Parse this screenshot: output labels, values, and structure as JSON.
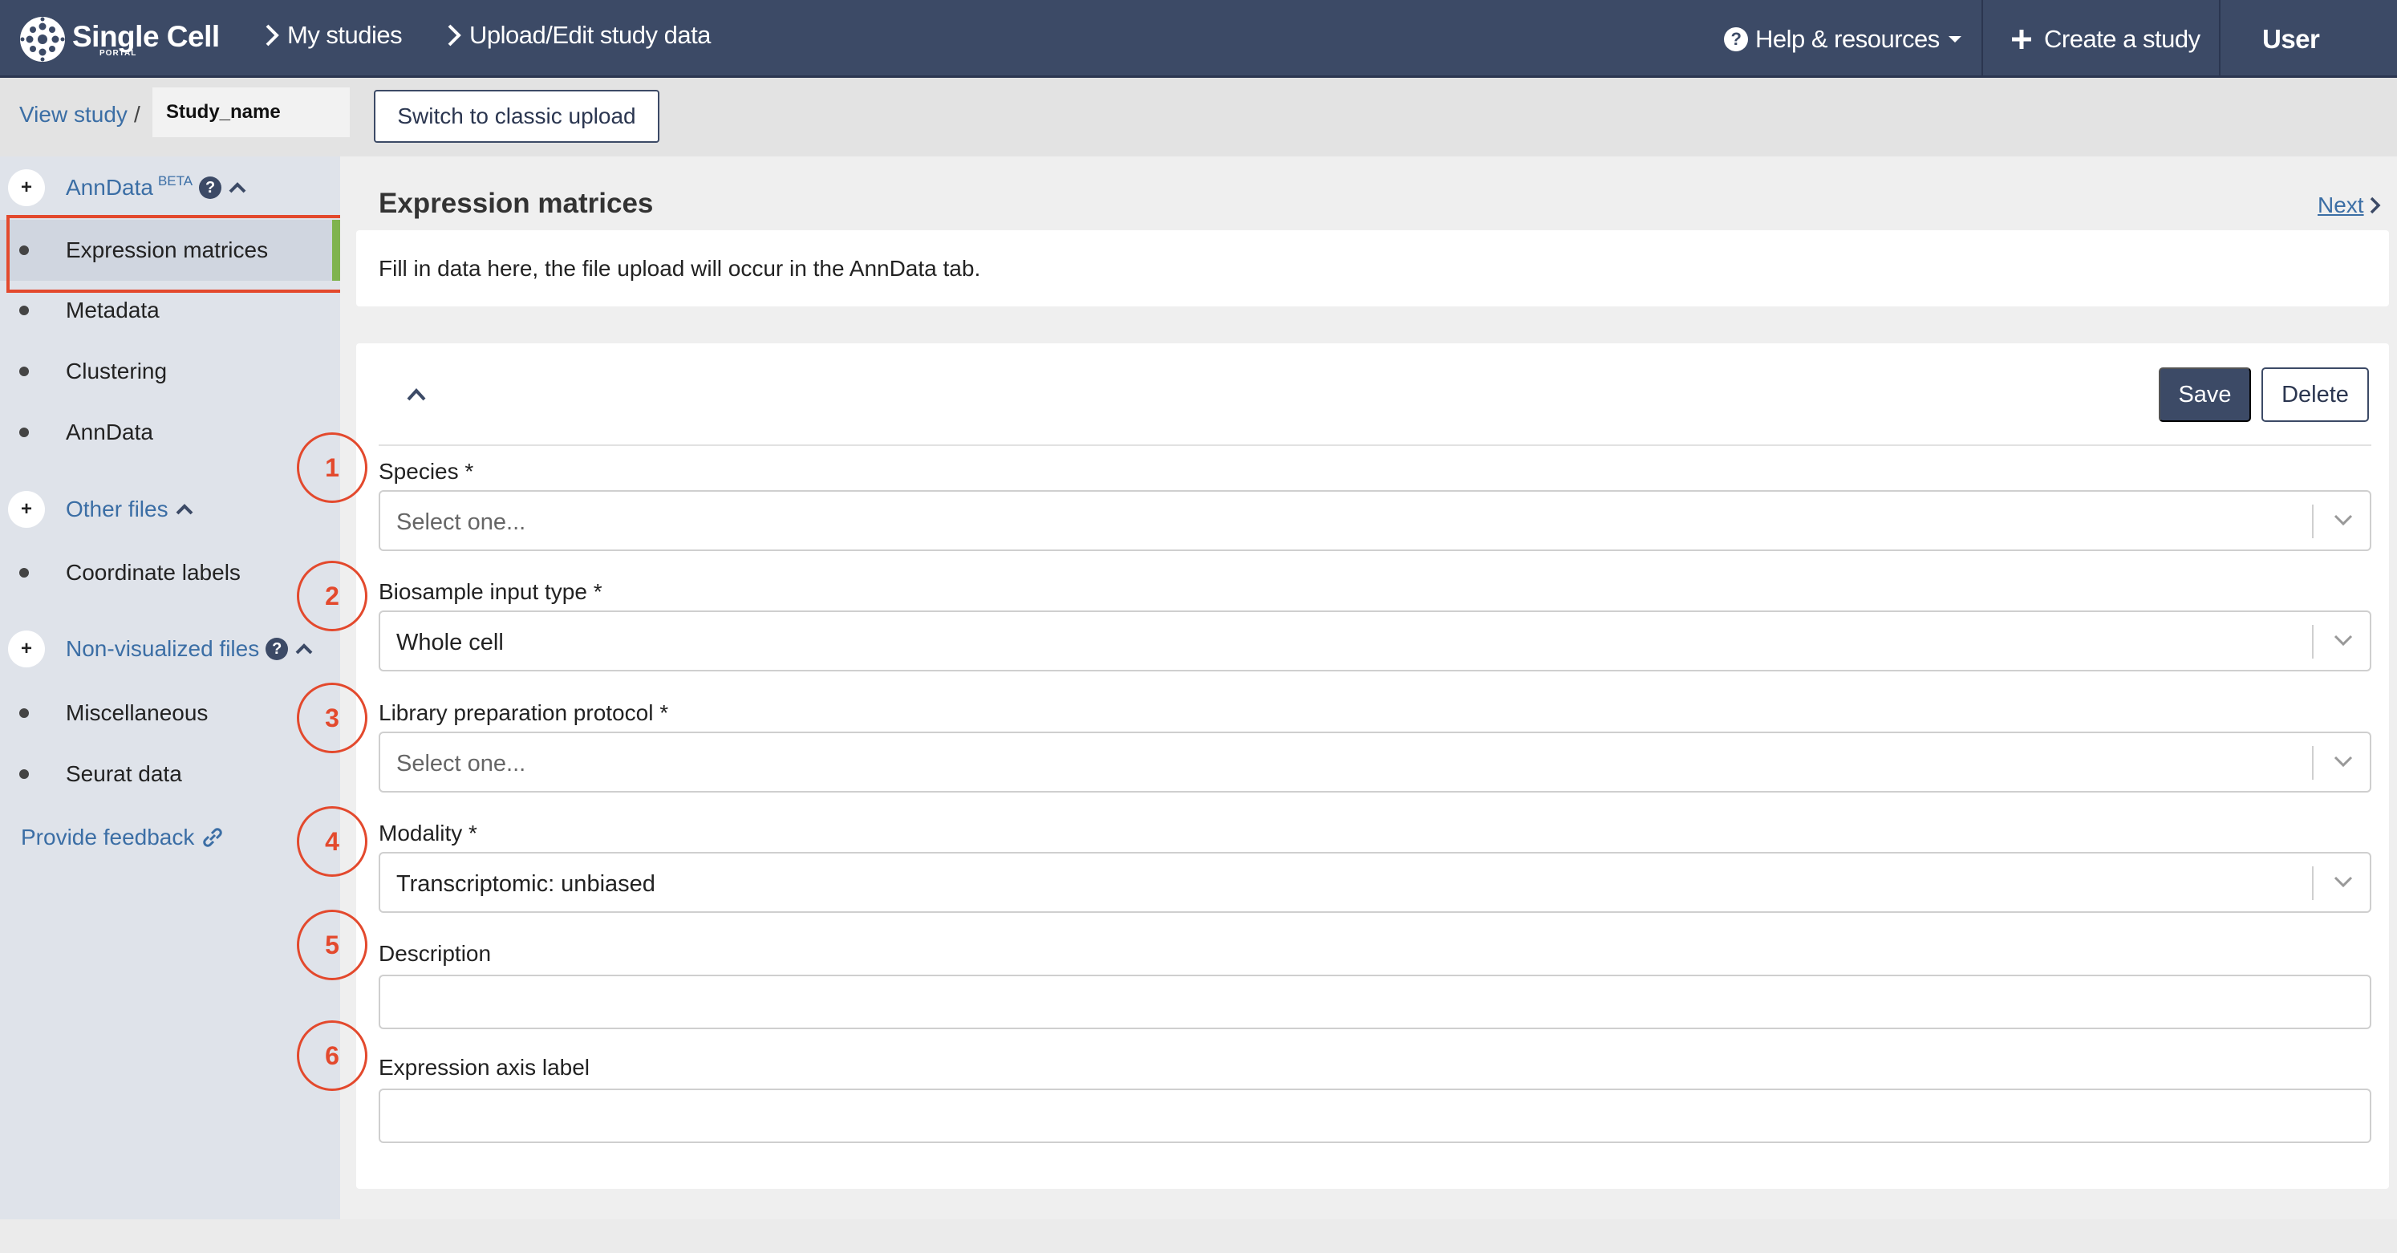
{
  "navbar": {
    "brand_name": "Single Cell",
    "brand_sub": "PORTAL",
    "crumb_my_studies": "My studies",
    "crumb_upload": "Upload/Edit study data",
    "help": "Help & resources",
    "create": "Create a study",
    "user": "User"
  },
  "subheader": {
    "view_study": "View study",
    "slash": "/",
    "study_name": "Study_name",
    "classic_button": "Switch to classic upload"
  },
  "sidebar": {
    "anndata_head": "AnnData",
    "anndata_badge": "BETA",
    "items_anndata": [
      "Expression matrices",
      "Metadata",
      "Clustering",
      "AnnData"
    ],
    "other_head": "Other files",
    "items_other": [
      "Coordinate labels"
    ],
    "nonvis_head": "Non-visualized files",
    "items_nonvis": [
      "Miscellaneous",
      "Seurat data"
    ],
    "feedback": "Provide feedback",
    "plus": "+"
  },
  "main": {
    "title": "Expression matrices",
    "next": "Next",
    "info": "Fill in data here, the file upload will occur in the AnnData tab.",
    "save": "Save",
    "delete": "Delete",
    "fields": [
      {
        "label": "Species *",
        "value": "Select one..."
      },
      {
        "label": "Biosample input type *",
        "value": "Whole cell"
      },
      {
        "label": "Library preparation protocol *",
        "value": "Select one..."
      },
      {
        "label": "Modality *",
        "value": "Transcriptomic: unbiased"
      },
      {
        "label": "Description",
        "value": ""
      },
      {
        "label": "Expression axis label",
        "value": ""
      }
    ]
  },
  "annotations": [
    "1",
    "2",
    "3",
    "4",
    "5",
    "6"
  ],
  "colors": {
    "navbar": "#3c4a66",
    "link": "#3b6ea5",
    "annotation_red": "#e3492d",
    "active_green": "#7fb34e"
  }
}
